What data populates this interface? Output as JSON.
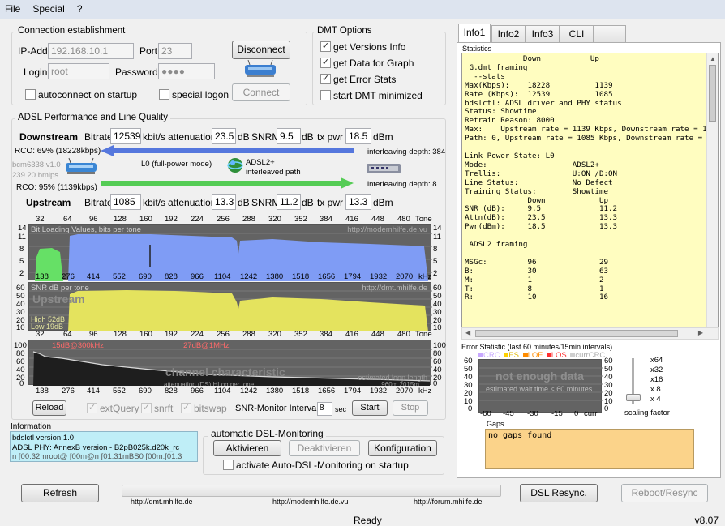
{
  "menu": [
    "File",
    "Special",
    "?"
  ],
  "connection": {
    "title": "Connection establishment",
    "ip_label": "IP-Add.",
    "ip_value": "192.168.10.1",
    "port_label": "Port",
    "port_value": "23",
    "login_label": "Login",
    "login_value": "root",
    "password_label": "Password",
    "password_value": "●●●●",
    "disconnect": "Disconnect",
    "connect": "Connect",
    "autoconnect": "autoconnect on startup",
    "special_logon": "special logon"
  },
  "dmt": {
    "title": "DMT Options",
    "opts": [
      {
        "label": "get Versions Info",
        "checked": true
      },
      {
        "label": "get Data for Graph",
        "checked": true
      },
      {
        "label": "get Error Stats",
        "checked": true
      },
      {
        "label": "start DMT minimized",
        "checked": false
      }
    ]
  },
  "adsl": {
    "title": "ADSL Performance and Line Quality",
    "down_label": "Downstream",
    "up_label": "Upstream",
    "bitrate_label": "Bitrate",
    "atten_label": "attenuation",
    "snrm_label": "SNRM",
    "txpwr_label": "tx pwr",
    "kbits": "kbit/s",
    "db": "dB",
    "dbm": "dBm",
    "down": {
      "bitrate": "12539",
      "atten": "23.5",
      "snrm": "9.5",
      "txpwr": "18.5"
    },
    "up": {
      "bitrate": "1085",
      "atten": "13.3",
      "snrm": "11.2",
      "txpwr": "13.3"
    },
    "rco_down": "RCO: 69% (18228kbps)",
    "rco_up": "RCO: 95% (1139kbps)",
    "il_down": "interleaving depth: 384",
    "il_up": "interleaving depth: 8",
    "mode": "L0 (full-power mode)",
    "adsl_mode": "ADSL2+",
    "adsl_path": "interleaved path",
    "chip": "bcm6338 v1.0",
    "chip_speed": "239.20 bmips"
  },
  "charts": {
    "tone_ticks": [
      "32",
      "64",
      "96",
      "128",
      "160",
      "192",
      "224",
      "256",
      "288",
      "320",
      "352",
      "384",
      "416",
      "448",
      "480",
      "Tone"
    ],
    "khz_ticks": [
      "138",
      "276",
      "414",
      "552",
      "690",
      "828",
      "966",
      "1104",
      "1242",
      "1380",
      "1518",
      "1656",
      "1794",
      "1932",
      "2070",
      "kHz"
    ],
    "bit_loading_title": "Bit Loading Values, bits per tone",
    "bit_loading_url": "http://modemhilfe.de.vu",
    "bit_y": [
      "14",
      "11",
      "8",
      "5",
      "2"
    ],
    "snr_title": "SNR  dB per tone",
    "snr_url": "http://dmt.mhilfe.de",
    "snr_watermark": "Upstream",
    "snr_high": "High 52dB",
    "snr_low": "Low   19dB",
    "snr_y": [
      "60",
      "50",
      "40",
      "30",
      "20",
      "10"
    ],
    "ch_y": [
      "100",
      "80",
      "60",
      "40",
      "20",
      "0"
    ],
    "ch_ann1": "15dB@300kHz",
    "ch_ann2": "27dB@1MHz",
    "ch_watermark": "channel characteristic",
    "ch_loop": "estimated loop length",
    "ch_loop2": "960m    2015m",
    "ch_attn": "attenuation (DS)   HLog per tone"
  },
  "chart_controls": {
    "reload": "Reload",
    "extquery": "extQuery",
    "snrft": "snrft",
    "bitswap": "bitswap",
    "interval_label": "SNR-Monitor Interval:",
    "interval_value": "8",
    "sec": "sec",
    "start": "Start",
    "stop": "Stop"
  },
  "information": {
    "title": "Information",
    "lines": [
      "bdslctl version 1.0",
      "ADSL PHY: AnnexB version - B2pB025k.d20k_rc",
      "n [00:32mroot@ [00m@n [01:31mBS0 [00m:[01:3"
    ]
  },
  "auto_dsl": {
    "title": "automatic DSL-Monitoring",
    "activate": "Aktivieren",
    "deactivate": "Deaktivieren",
    "config": "Konfiguration",
    "startup": "activate Auto-DSL-Monitoring on startup"
  },
  "tabs": [
    "Info1",
    "Info2",
    "Info3",
    "CLI"
  ],
  "stats_label": "Statistics",
  "stats_text": "             Down           Up\n G.dmt framing\n  --stats\nMax(Kbps):    18228          1139\nRate (Kbps):  12539          1085\nbdslctl: ADSL driver and PHY status\nStatus: Showtime\nRetrain Reason: 8000\nMax:    Upstream rate = 1139 Kbps, Downstream rate = 18228 Kbps\nPath: 0, Upstream rate = 1085 Kbps, Downstream rate = 12539 Kbps\n\nLink Power State: L0\nMode:                   ADSL2+\nTrellis:                U:ON /D:ON\nLine Status:            No Defect\nTraining Status:        Showtime\n              Down            Up\nSNR (dB):     9.5             11.2\nAttn(dB):     23.5            13.3\nPwr(dBm):     18.5            13.3\n\n ADSL2 framing\n\nMSGc:         96              29\nB:            30              63\nM:            1               2\nT:            8               1\nR:            10              16",
  "error_stat": {
    "title": "Error Statistic (last 60 minutes/15min.intervals)",
    "legend": [
      {
        "label": "CRC",
        "color": "#c8a8ff"
      },
      {
        "label": "ES",
        "color": "#ffd200"
      },
      {
        "label": "LOF",
        "color": "#ff8c00"
      },
      {
        "label": "LOS",
        "color": "#ff3030"
      },
      {
        "label": "currCRC",
        "color": "#cfcfcf"
      }
    ],
    "no_data": "not enough data",
    "wait": "estimated wait time < 60 minutes",
    "y": [
      "60",
      "50",
      "40",
      "30",
      "20",
      "10",
      "0"
    ],
    "x": [
      "-60",
      "-45",
      "-30",
      "-15",
      "0",
      "curr"
    ],
    "scale": [
      "x64",
      "x32",
      "x16",
      "x 8",
      "x 4"
    ],
    "scaling_label": "scaling factor"
  },
  "gaps": {
    "title": "Gaps",
    "text": "no gaps found"
  },
  "bottom": {
    "refresh": "Refresh",
    "resync": "DSL Resync.",
    "reboot": "Reboot/Resync",
    "links": [
      "http://dmt.mhilfe.de",
      "http://modemhilfe.de.vu",
      "http://forum.mhilfe.de"
    ]
  },
  "status": {
    "text": "Ready",
    "version": "v8.07"
  },
  "colors": {
    "bit_loading": "#7f9cf5",
    "upstream_green": "#66e066",
    "snr": "#e4e35e",
    "chart_bg": "#636363",
    "arrow_down": "#5577dd",
    "arrow_up": "#55cc55",
    "info_bg": "#bfeef7",
    "stats_bg": "#fffdc0",
    "gaps_bg": "#fbd38a"
  }
}
